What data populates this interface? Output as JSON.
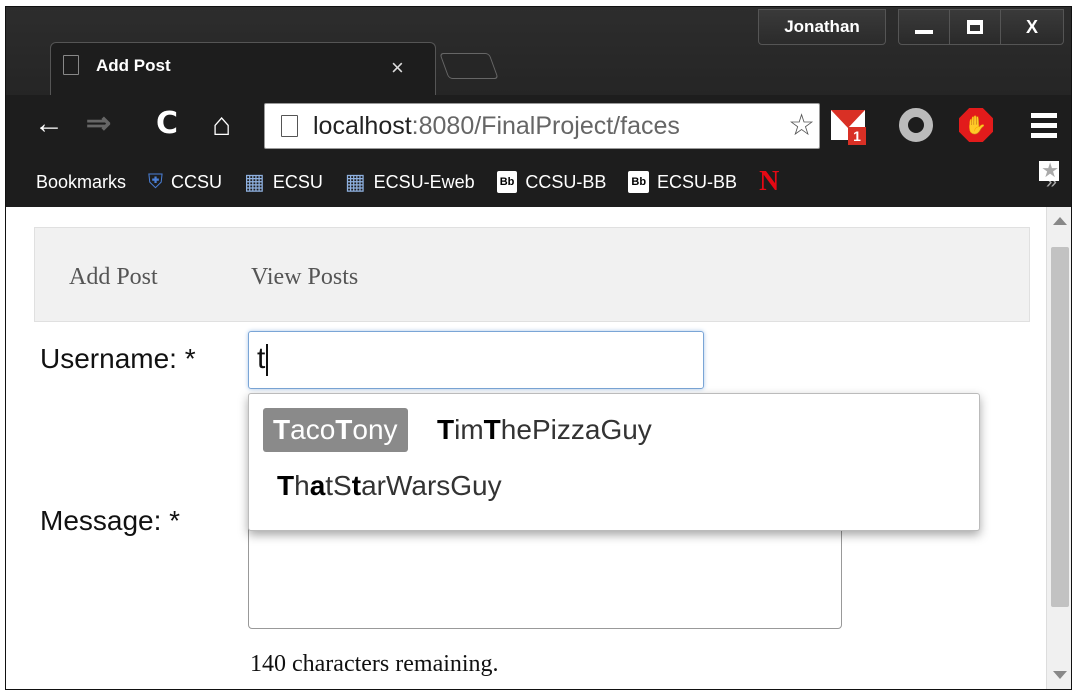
{
  "window": {
    "profile_name": "Jonathan",
    "close_glyph": "X"
  },
  "tab": {
    "title": "Add Post",
    "close_glyph": "×"
  },
  "toolbar": {
    "back_glyph": "←",
    "forward_glyph": "⇒",
    "reload_glyph": "C",
    "home_glyph": "⌂",
    "url_host": "localhost",
    "url_rest": ":8080/FinalProject/faces",
    "star_glyph": "☆",
    "gmail_badge": "1"
  },
  "bookmarks": {
    "items": [
      {
        "label": "Bookmarks",
        "icon": "star-icon"
      },
      {
        "label": "CCSU",
        "icon": "shield-icon"
      },
      {
        "label": "ECSU",
        "icon": "building-icon"
      },
      {
        "label": "ECSU-Eweb",
        "icon": "building-icon"
      },
      {
        "label": "CCSU-BB",
        "icon": "blackboard-icon"
      },
      {
        "label": "ECSU-BB",
        "icon": "blackboard-icon"
      }
    ],
    "bb_glyph": "Bb",
    "netflix_glyph": "N",
    "overflow_glyph": "»"
  },
  "nav": {
    "add_post": "Add Post",
    "view_posts": "View Posts"
  },
  "form": {
    "username_label": "Username: *",
    "username_value": "t",
    "message_label": "Message: *",
    "remaining": "140 characters remaining."
  },
  "suggestions": [
    {
      "label": "TacoTony",
      "selected": true
    },
    {
      "label": "TimThePizzaGuy",
      "selected": false
    },
    {
      "label": "ThatStarWarsGuy",
      "selected": false
    }
  ],
  "colors": {
    "chrome_dark": "#1d1d1d",
    "focus_blue": "#7aa5d6",
    "selected_chip": "#8a8a8a"
  }
}
